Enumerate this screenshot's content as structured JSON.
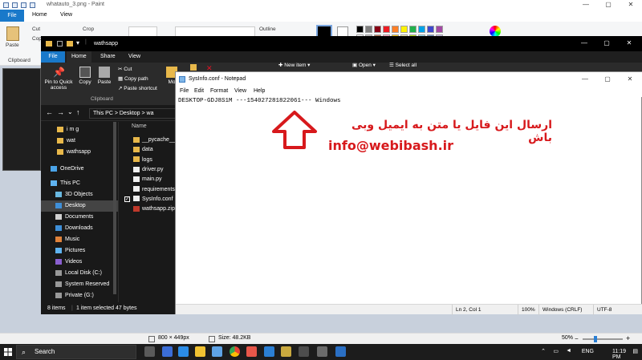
{
  "paint": {
    "title": "whatauto_3.png - Paint",
    "tabs": [
      "File",
      "Home",
      "View"
    ],
    "clipboard": {
      "paste": "Paste",
      "cut": "Cut",
      "copy": "Copy",
      "label": "Clipboard"
    },
    "image": {
      "crop": "Crop"
    },
    "shapes": {
      "outline": "Outline"
    },
    "status": {
      "dimensions": "800 × 449px",
      "size": "Size: 48.2KB",
      "zoom": "50%"
    },
    "palette": [
      "#000000",
      "#ffffff",
      "#7f7f7f",
      "#c3c3c3",
      "#880015",
      "#b97a57",
      "#ed1c24",
      "#ffaec9",
      "#ff7f27",
      "#ffc90e",
      "#fff200",
      "#efe4b0",
      "#22b14c",
      "#b5e61d",
      "#00a2e8",
      "#99d9ea",
      "#3f48cc",
      "#7092be",
      "#a349a4",
      "#c8bfe7"
    ]
  },
  "explorer": {
    "title": "wathsapp",
    "tabs": [
      "File",
      "Home",
      "Share",
      "View"
    ],
    "ribbon": {
      "pin": "Pin to Quick access",
      "copy": "Copy",
      "paste": "Paste",
      "cut": "Cut",
      "copy_path": "Copy path",
      "paste_shortcut": "Paste shortcut",
      "clipboard_label": "Clipboard",
      "move_to": "Mo",
      "new_item": "New item",
      "open": "Open",
      "select_all": "Select all"
    },
    "address": "This PC  >  Desktop  >  wa",
    "nav": [
      {
        "label": "i m g",
        "icon": "folder-icon"
      },
      {
        "label": "wat",
        "icon": "folder-icon"
      },
      {
        "label": "wathsapp",
        "icon": "folder-icon"
      },
      {
        "label": "OneDrive",
        "icon": "cloud-icon"
      },
      {
        "label": "This PC",
        "icon": "pc-icon"
      },
      {
        "label": "3D Objects",
        "icon": "cube-icon"
      },
      {
        "label": "Desktop",
        "icon": "desktop-icon"
      },
      {
        "label": "Documents",
        "icon": "documents-icon"
      },
      {
        "label": "Downloads",
        "icon": "download-icon"
      },
      {
        "label": "Music",
        "icon": "music-icon"
      },
      {
        "label": "Pictures",
        "icon": "pictures-icon"
      },
      {
        "label": "Videos",
        "icon": "videos-icon"
      },
      {
        "label": "Local Disk (C:)",
        "icon": "disk-icon"
      },
      {
        "label": "System Reserved",
        "icon": "disk-icon"
      },
      {
        "label": "Private (G:)",
        "icon": "disk-icon"
      }
    ],
    "column_header": "Name",
    "files": [
      {
        "name": "__pycache__",
        "type": "folder"
      },
      {
        "name": "data",
        "type": "folder"
      },
      {
        "name": "logs",
        "type": "folder"
      },
      {
        "name": "driver.py",
        "type": "file"
      },
      {
        "name": "main.py",
        "type": "file"
      },
      {
        "name": "requirements.",
        "type": "file"
      },
      {
        "name": "SysInfo.conf",
        "type": "file"
      },
      {
        "name": "wathsapp.zip",
        "type": "zip"
      }
    ],
    "status": {
      "items": "8 items",
      "selected": "1 item selected  47 bytes"
    }
  },
  "notepad": {
    "title": "SysInfo.conf - Notepad",
    "menu": [
      "File",
      "Edit",
      "Format",
      "View",
      "Help"
    ],
    "content": "DESKTOP-GDJ8S1M ---154027281822061--- Windows",
    "status": {
      "position": "Ln 2, Col 1",
      "zoom": "100%",
      "line_ending": "Windows (CRLF)",
      "encoding": "UTF-8"
    }
  },
  "annotation": {
    "text": "ارسال این فایل یا متن به ایمیل وبی باش",
    "email": "info@webibash.ir",
    "color": "#d7191c"
  },
  "taskbar": {
    "search_placeholder": "Search",
    "language": "ENG",
    "time": "11:19 PM"
  }
}
